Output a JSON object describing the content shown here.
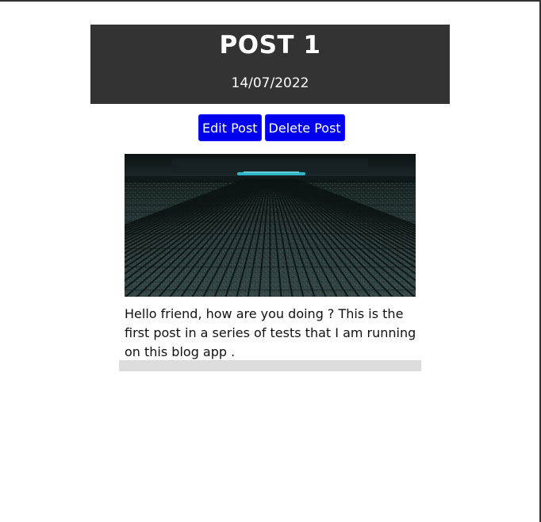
{
  "post": {
    "title": "POST 1",
    "date": "14/07/2022",
    "body": "Hello friend, how are you doing ? This is the first post in a series of tests that I am running on this blog app ."
  },
  "actions": {
    "edit_label": "Edit Post",
    "delete_label": "Delete Post"
  },
  "colors": {
    "header_bg": "#333333",
    "button_bg": "#0000ee"
  }
}
